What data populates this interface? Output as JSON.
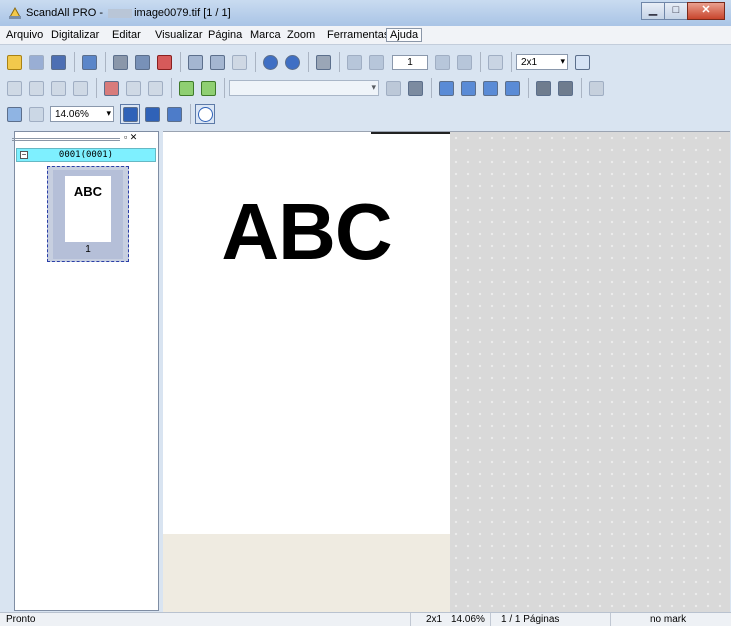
{
  "window": {
    "title_prefix": "ScandAll PRO - ",
    "title_suffix": "image0079.tif  [1 / 1]",
    "min_glyph": "▁",
    "max_glyph": "□",
    "close_glyph": "✕"
  },
  "menu": [
    "Arquivo",
    "Digitalizar",
    "Editar",
    "Visualizar",
    "Página",
    "Marca",
    "Zoom",
    "Ferramentas",
    "Ajuda"
  ],
  "toolbar": {
    "page_number": "1",
    "layout_combo": "2x1",
    "zoom_combo": "14.06%",
    "dropdown_arrow": "▾"
  },
  "thumbnail_panel": {
    "pin_glyphs": "▫ ✕",
    "node_toggle": "−",
    "node_label": "0001(0001)",
    "thumb_text": "ABC",
    "thumb_number": "1"
  },
  "document": {
    "text": "ABC"
  },
  "status": {
    "message": "Pronto",
    "layout": "2x1",
    "zoom": "14.06%",
    "pages": "1 / 1 Páginas",
    "mark": "no mark"
  },
  "colors": {
    "node_bg": "#7ef0ff",
    "viewer_bg": "#d9d9d9",
    "page_strip": "#efebe1"
  }
}
